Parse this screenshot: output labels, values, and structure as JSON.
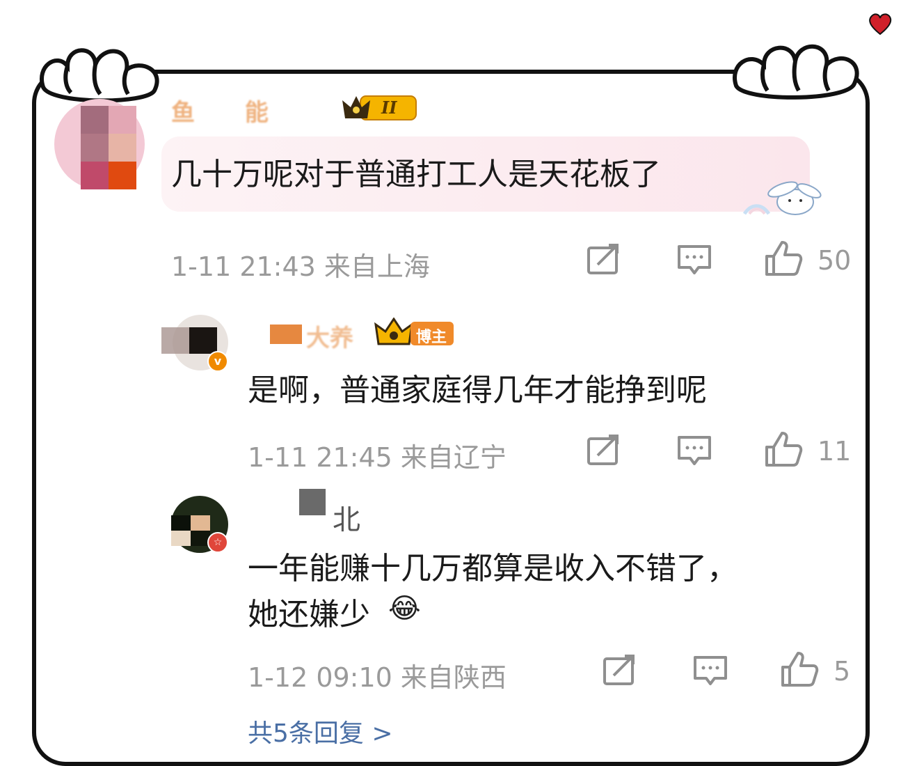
{
  "comments": [
    {
      "user_name_visible": "鱼 能",
      "text": "几十万呢对于普通打工人是天花板了",
      "meta": "1-11 21:43 来自上海",
      "likes": "50",
      "badge": "II"
    },
    {
      "user_name_visible": "大养",
      "badge": "博主",
      "text": "是啊，普通家庭得几年才能挣到呢",
      "meta": "1-11 21:45 来自辽宁",
      "likes": "11"
    },
    {
      "user_name_visible": "北",
      "text_line1": "一年能赚十几万都算是收入不错了，",
      "text_line2": "她还嫌少",
      "emoji": "😂",
      "meta": "1-12 09:10 来自陕西",
      "likes": "5"
    }
  ],
  "footer": {
    "more_replies": "共5条回复 >"
  },
  "colors": {
    "frame": "#111111",
    "meta": "#9a9a9a",
    "heart": "#d0202a",
    "vip_gold": "#f5b400",
    "blogger_badge": "#f08a2a"
  },
  "icons": [
    "share-icon",
    "comment-icon",
    "like-icon",
    "heart-icon",
    "crown-icon"
  ]
}
